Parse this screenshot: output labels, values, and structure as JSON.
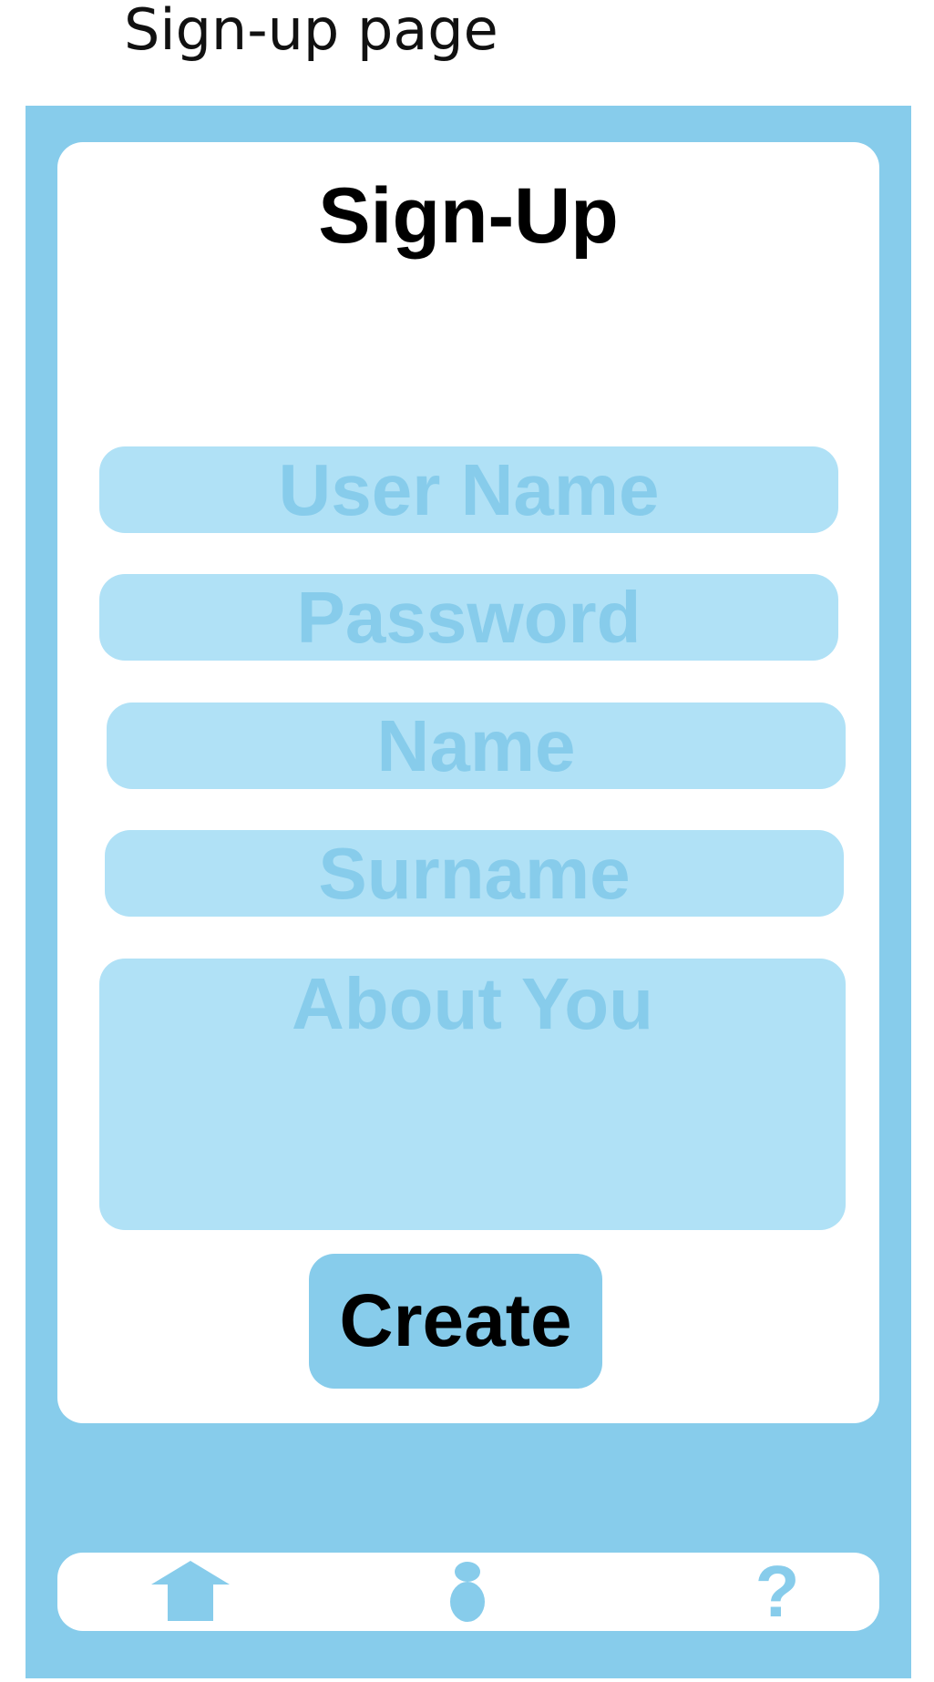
{
  "page": {
    "caption": "Sign-up page"
  },
  "form": {
    "title": "Sign-Up",
    "fields": {
      "username": {
        "placeholder": "User Name"
      },
      "password": {
        "placeholder": "Password"
      },
      "name": {
        "placeholder": "Name"
      },
      "surname": {
        "placeholder": "Surname"
      },
      "about": {
        "placeholder": "About You"
      }
    },
    "submit_label": "Create"
  },
  "nav": {
    "items": [
      {
        "id": "home",
        "icon": "home-icon"
      },
      {
        "id": "profile",
        "icon": "user-icon"
      },
      {
        "id": "help",
        "icon": "help-icon",
        "glyph": "?"
      }
    ]
  },
  "colors": {
    "frame": "#87cceb",
    "field_fill": "#b0e1f6",
    "placeholder_text": "#87cceb",
    "card": "#ffffff",
    "button": "#87cceb",
    "title_text": "#000000"
  }
}
